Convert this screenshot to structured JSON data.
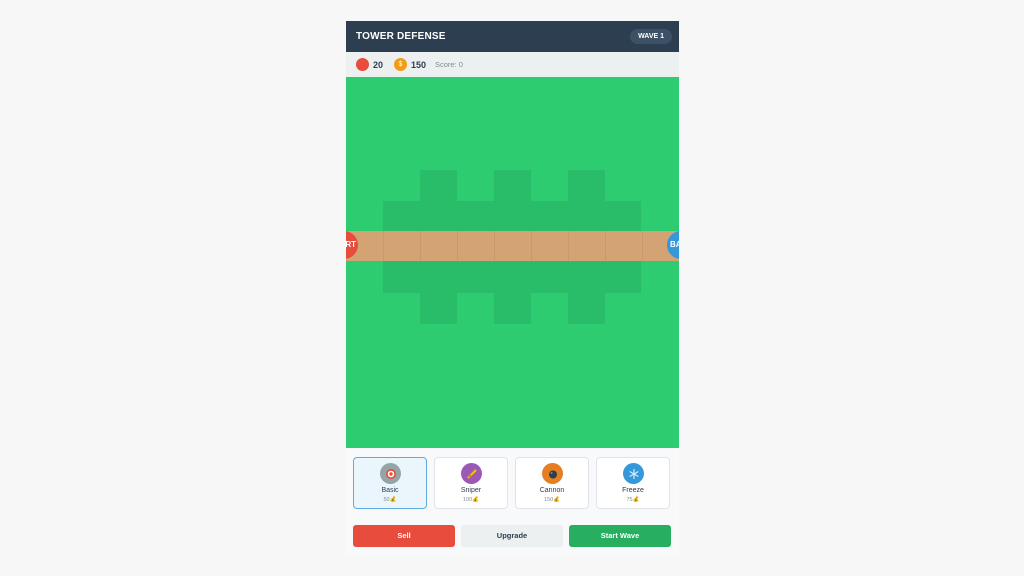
{
  "header": {
    "title": "TOWER DEFENSE",
    "wave_label": "WAVE 1"
  },
  "stats": {
    "lives": "20",
    "gold": "150",
    "score": "Score: 0"
  },
  "board": {
    "start_label": "START",
    "base_label": "BASE"
  },
  "towers": [
    {
      "name": "Basic",
      "cost": "50",
      "color": "#95a5a6",
      "icon": "target-icon",
      "selected": true
    },
    {
      "name": "Sniper",
      "cost": "100",
      "color": "#9b59b6",
      "icon": "rifle-icon",
      "selected": false
    },
    {
      "name": "Cannon",
      "cost": "150",
      "color": "#e67e22",
      "icon": "cannonball-icon",
      "selected": false
    },
    {
      "name": "Freeze",
      "cost": "75",
      "color": "#3498db",
      "icon": "snowflake-icon",
      "selected": false
    }
  ],
  "coin_symbol": "💰",
  "actions": {
    "sell": "Sell",
    "upgrade": "Upgrade",
    "start_wave": "Start Wave"
  },
  "colors": {
    "header": "#2c3e50",
    "grass": "#2ecc71",
    "path": "#d4a373"
  }
}
